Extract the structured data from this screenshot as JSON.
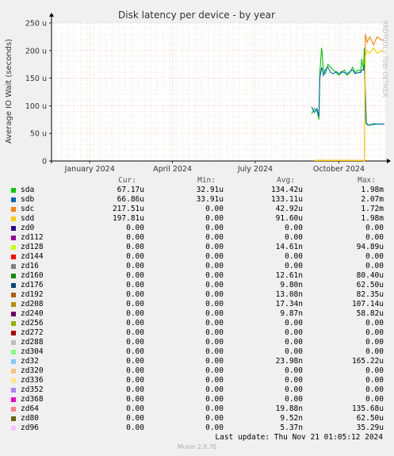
{
  "side_text": "RRDTOOL / TOBI OETIKER",
  "footer": {
    "last_update": "Last update:  Thu Nov 21 01:05:12 2024",
    "munin_version": "Munin 2.0.76"
  },
  "legend_headers": {
    "cur": "Cur:",
    "min": "Min:",
    "avg": "Avg:",
    "max": "Max:"
  },
  "legend": [
    {
      "name": "sda",
      "color": "#00cc00",
      "cur": "67.17u",
      "min": "32.91u",
      "avg": "134.42u",
      "max": "1.98m"
    },
    {
      "name": "sdb",
      "color": "#0066b3",
      "cur": "66.86u",
      "min": "33.91u",
      "avg": "133.11u",
      "max": "2.07m"
    },
    {
      "name": "sdc",
      "color": "#ff8000",
      "cur": "217.51u",
      "min": "0.00",
      "avg": "42.92u",
      "max": "1.72m"
    },
    {
      "name": "sdd",
      "color": "#ffcc00",
      "cur": "197.81u",
      "min": "0.00",
      "avg": "91.60u",
      "max": "1.98m"
    },
    {
      "name": "zd0",
      "color": "#330099",
      "cur": "0.00",
      "min": "0.00",
      "avg": "0.00",
      "max": "0.00"
    },
    {
      "name": "zd112",
      "color": "#990099",
      "cur": "0.00",
      "min": "0.00",
      "avg": "0.00",
      "max": "0.00"
    },
    {
      "name": "zd128",
      "color": "#ccff00",
      "cur": "0.00",
      "min": "0.00",
      "avg": "14.61n",
      "max": "94.89u"
    },
    {
      "name": "zd144",
      "color": "#ff0000",
      "cur": "0.00",
      "min": "0.00",
      "avg": "0.00",
      "max": "0.00"
    },
    {
      "name": "zd16",
      "color": "#808080",
      "cur": "0.00",
      "min": "0.00",
      "avg": "0.00",
      "max": "0.00"
    },
    {
      "name": "zd160",
      "color": "#008f00",
      "cur": "0.00",
      "min": "0.00",
      "avg": "12.61n",
      "max": "80.40u"
    },
    {
      "name": "zd176",
      "color": "#00487d",
      "cur": "0.00",
      "min": "0.00",
      "avg": "9.80n",
      "max": "62.50u"
    },
    {
      "name": "zd192",
      "color": "#b35a00",
      "cur": "0.00",
      "min": "0.00",
      "avg": "13.08n",
      "max": "82.35u"
    },
    {
      "name": "zd208",
      "color": "#b38f00",
      "cur": "0.00",
      "min": "0.00",
      "avg": "17.34n",
      "max": "107.14u"
    },
    {
      "name": "zd240",
      "color": "#6b006b",
      "cur": "0.00",
      "min": "0.00",
      "avg": "9.87n",
      "max": "58.82u"
    },
    {
      "name": "zd256",
      "color": "#8fb300",
      "cur": "0.00",
      "min": "0.00",
      "avg": "0.00",
      "max": "0.00"
    },
    {
      "name": "zd272",
      "color": "#b30000",
      "cur": "0.00",
      "min": "0.00",
      "avg": "0.00",
      "max": "0.00"
    },
    {
      "name": "zd288",
      "color": "#bebebe",
      "cur": "0.00",
      "min": "0.00",
      "avg": "0.00",
      "max": "0.00"
    },
    {
      "name": "zd304",
      "color": "#80ff80",
      "cur": "0.00",
      "min": "0.00",
      "avg": "0.00",
      "max": "0.00"
    },
    {
      "name": "zd32",
      "color": "#80c9ff",
      "cur": "0.00",
      "min": "0.00",
      "avg": "23.98n",
      "max": "165.22u"
    },
    {
      "name": "zd320",
      "color": "#ffc080",
      "cur": "0.00",
      "min": "0.00",
      "avg": "0.00",
      "max": "0.00"
    },
    {
      "name": "zd336",
      "color": "#ffe680",
      "cur": "0.00",
      "min": "0.00",
      "avg": "0.00",
      "max": "0.00"
    },
    {
      "name": "zd352",
      "color": "#aa80ff",
      "cur": "0.00",
      "min": "0.00",
      "avg": "0.00",
      "max": "0.00"
    },
    {
      "name": "zd368",
      "color": "#ee00cc",
      "cur": "0.00",
      "min": "0.00",
      "avg": "0.00",
      "max": "0.00"
    },
    {
      "name": "zd64",
      "color": "#ff8080",
      "cur": "0.00",
      "min": "0.00",
      "avg": "19.88n",
      "max": "135.68u"
    },
    {
      "name": "zd80",
      "color": "#666600",
      "cur": "0.00",
      "min": "0.00",
      "avg": "9.52n",
      "max": "62.50u"
    },
    {
      "name": "zd96",
      "color": "#ffbfff",
      "cur": "0.00",
      "min": "0.00",
      "avg": "5.37n",
      "max": "35.29u"
    }
  ],
  "chart_data": {
    "type": "line",
    "title": "Disk latency per device - by year",
    "ylabel": "Average IO Wait (seconds)",
    "xlabel": "",
    "ylim": [
      0,
      250
    ],
    "yticks": [
      0,
      50,
      100,
      150,
      200,
      250
    ],
    "ytick_labels": [
      "0",
      "50 u",
      "100 u",
      "150 u",
      "200 u",
      "250 u"
    ],
    "xlim": [
      "2023-11-20",
      "2024-11-21"
    ],
    "xticks": [
      "2024-01-01",
      "2024-04-01",
      "2024-07-01",
      "2024-10-01"
    ],
    "xtick_labels": [
      "January 2024",
      "April 2024",
      "July 2024",
      "October 2024"
    ],
    "grid": true,
    "y_unit": "u",
    "series": [
      {
        "name": "sda",
        "color": "#00cc00",
        "x": [
          "2024-09-01",
          "2024-09-04",
          "2024-09-07",
          "2024-09-09",
          "2024-09-10",
          "2024-09-12",
          "2024-09-14",
          "2024-09-16",
          "2024-09-19",
          "2024-09-22",
          "2024-09-25",
          "2024-09-28",
          "2024-10-01",
          "2024-10-04",
          "2024-10-07",
          "2024-10-10",
          "2024-10-13",
          "2024-10-16",
          "2024-10-19",
          "2024-10-22",
          "2024-10-25",
          "2024-10-26",
          "2024-10-28",
          "2024-10-29",
          "2024-10-31",
          "2024-11-02",
          "2024-11-05",
          "2024-11-08",
          "2024-11-12",
          "2024-11-16",
          "2024-11-20"
        ],
        "values": [
          85,
          95,
          90,
          75,
          160,
          205,
          165,
          158,
          175,
          170,
          165,
          160,
          155,
          160,
          165,
          155,
          160,
          170,
          160,
          165,
          162,
          185,
          165,
          205,
          70,
          65,
          65,
          68,
          67,
          67,
          67
        ]
      },
      {
        "name": "sdb",
        "color": "#0066b3",
        "x": [
          "2024-09-01",
          "2024-09-04",
          "2024-09-07",
          "2024-09-09",
          "2024-09-10",
          "2024-09-12",
          "2024-09-14",
          "2024-09-16",
          "2024-09-19",
          "2024-09-22",
          "2024-09-25",
          "2024-09-28",
          "2024-10-01",
          "2024-10-04",
          "2024-10-07",
          "2024-10-10",
          "2024-10-13",
          "2024-10-16",
          "2024-10-19",
          "2024-10-22",
          "2024-10-25",
          "2024-10-26",
          "2024-10-28",
          "2024-10-29",
          "2024-10-31",
          "2024-11-02",
          "2024-11-05",
          "2024-11-08",
          "2024-11-12",
          "2024-11-16",
          "2024-11-20"
        ],
        "values": [
          98,
          88,
          95,
          80,
          150,
          170,
          155,
          165,
          170,
          160,
          158,
          162,
          158,
          162,
          160,
          158,
          162,
          165,
          158,
          160,
          160,
          165,
          165,
          175,
          68,
          65,
          66,
          66,
          67,
          67,
          67
        ]
      },
      {
        "name": "sdc",
        "color": "#ff8000",
        "x": [
          "2024-09-04",
          "2024-10-28",
          "2024-10-29",
          "2024-10-30",
          "2024-11-01",
          "2024-11-04",
          "2024-11-08",
          "2024-11-12",
          "2024-11-16",
          "2024-11-20"
        ],
        "values": [
          1,
          1,
          0,
          230,
          215,
          225,
          210,
          225,
          220,
          218
        ]
      },
      {
        "name": "sdd",
        "color": "#ffcc00",
        "x": [
          "2024-09-04",
          "2024-10-28",
          "2024-10-29",
          "2024-10-30",
          "2024-11-01",
          "2024-11-04",
          "2024-11-08",
          "2024-11-12",
          "2024-11-16",
          "2024-11-20"
        ],
        "values": [
          1,
          1,
          0,
          190,
          200,
          195,
          205,
          195,
          200,
          198
        ]
      }
    ]
  }
}
